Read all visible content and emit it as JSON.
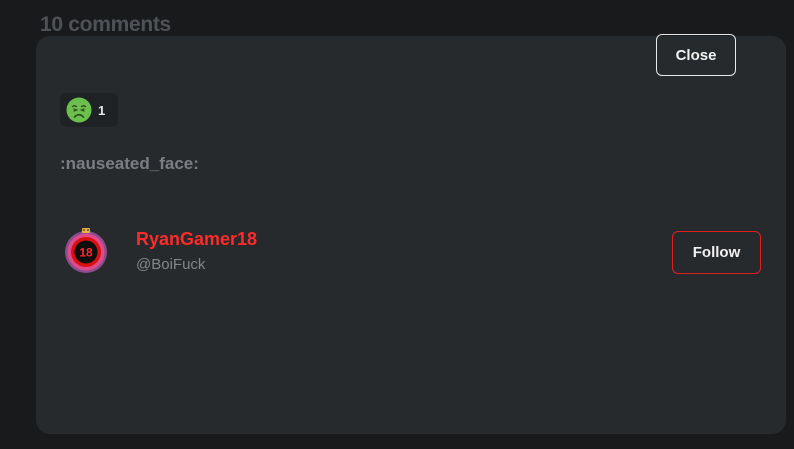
{
  "background": {
    "comments_title": "10 comments"
  },
  "modal": {
    "close_label": "Close",
    "reaction": {
      "emoji_icon": "nauseated-face-icon",
      "count": "1"
    },
    "emoji_name": ":nauseated_face:",
    "users": [
      {
        "display_name": "RyanGamer18",
        "handle": "@BoiFuck",
        "follow_label": "Follow",
        "avatar_icon": "18-badge-avatar",
        "name_color": "#ff2a2a"
      }
    ]
  },
  "colors": {
    "page_background": "#191a1b",
    "modal_background": "#272a2c",
    "follow_border": "#e0201c",
    "emoji_green": "#6cbf4d"
  }
}
